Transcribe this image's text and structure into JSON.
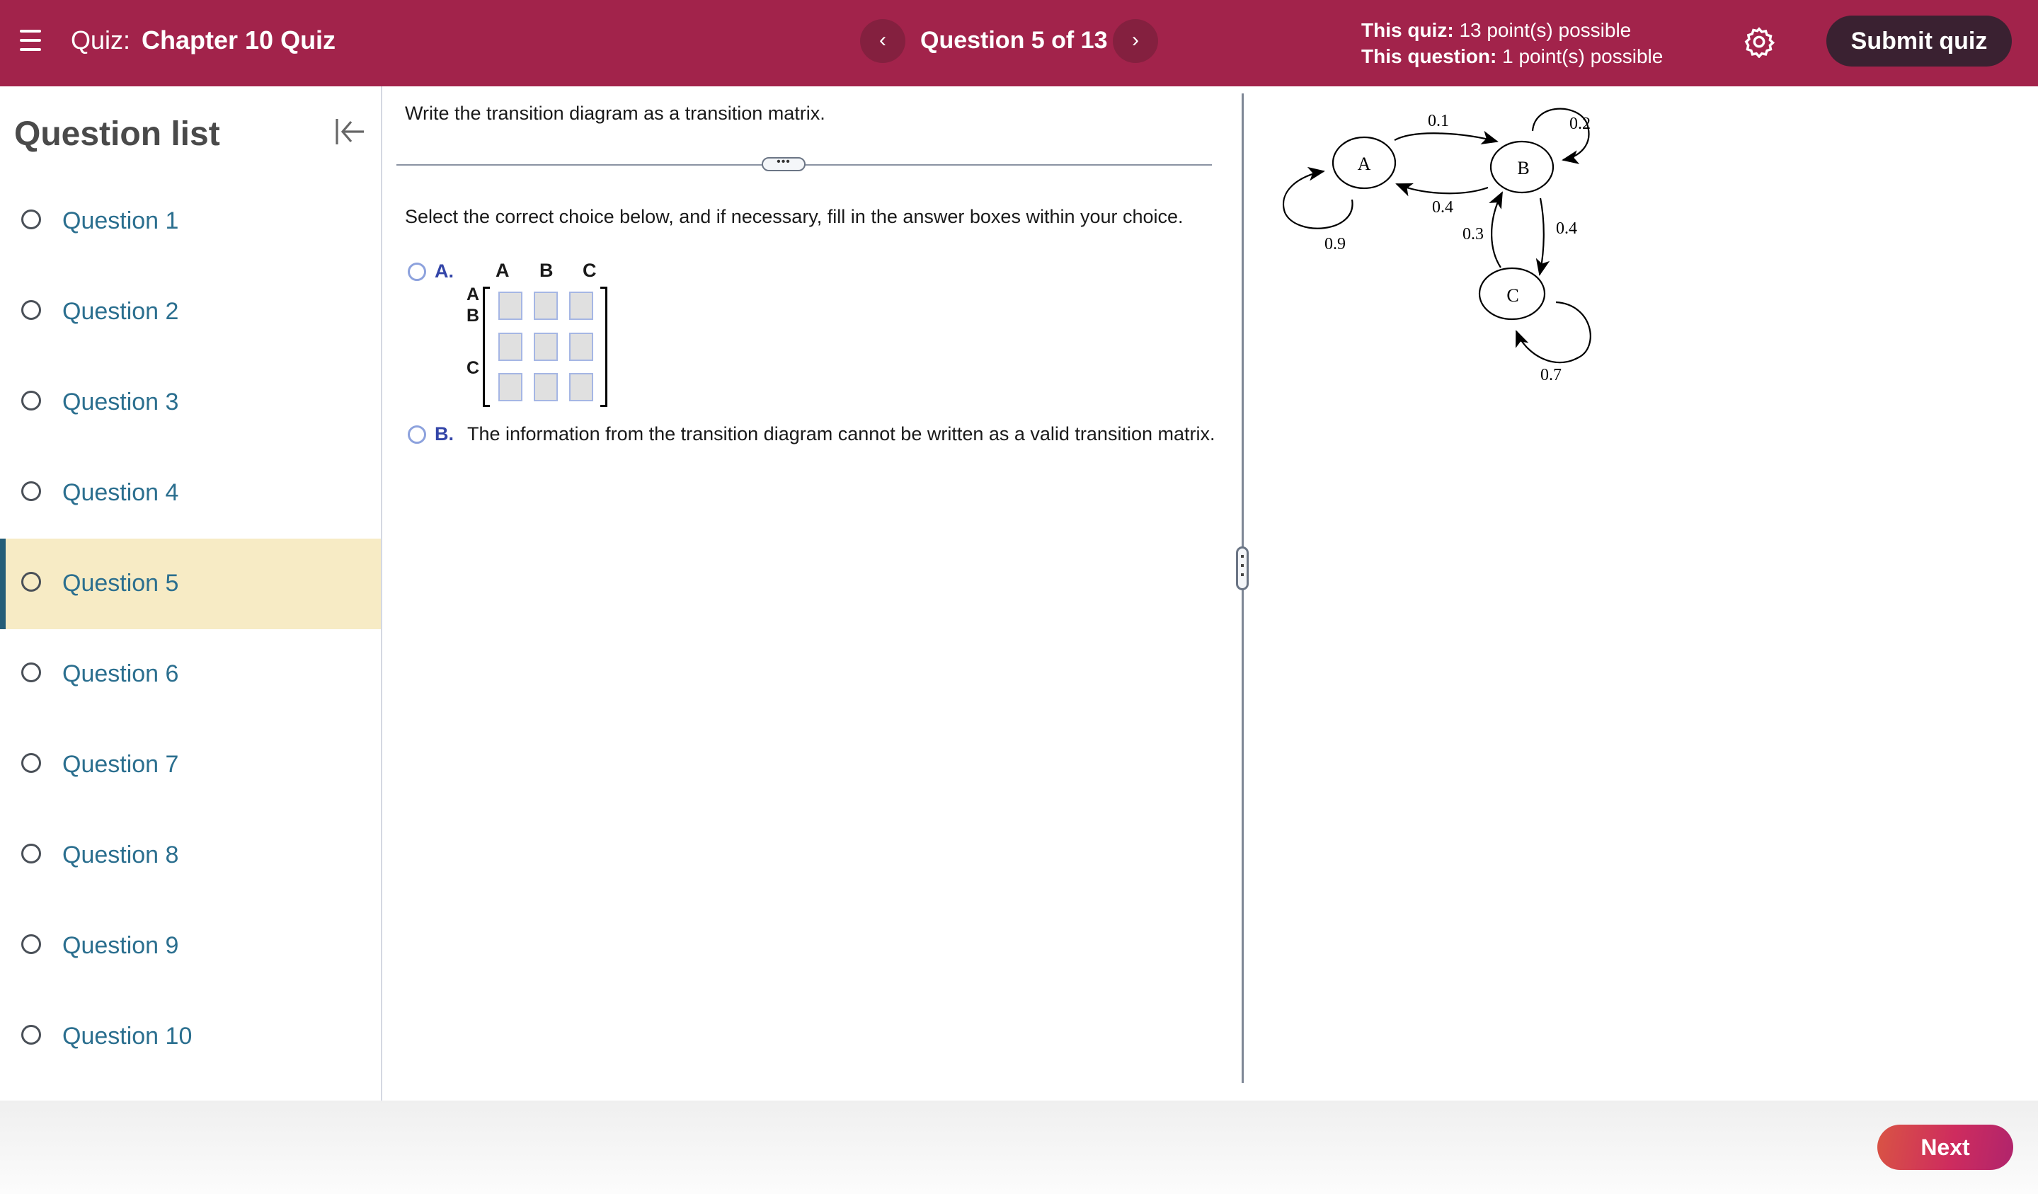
{
  "header": {
    "menu_icon": "hamburger-menu-icon",
    "quiz_label": "Quiz:",
    "quiz_title": "Chapter 10 Quiz",
    "prev_icon": "chevron-left-icon",
    "prev_glyph": "‹",
    "question_counter": "Question 5 of 13",
    "next_icon": "chevron-right-icon",
    "next_glyph": "›",
    "quiz_points_label": "This quiz:",
    "quiz_points_value": "13 point(s) possible",
    "question_points_label": "This question:",
    "question_points_value": "1 point(s) possible",
    "settings_icon": "gear-icon",
    "submit_label": "Submit quiz",
    "colors": {
      "header_bg": "#A2234B",
      "submit_bg": "#3A2131"
    }
  },
  "sidebar": {
    "title": "Question list",
    "collapse_icon": "collapse-left-icon",
    "active_index": 4,
    "items": [
      {
        "label": "Question 1"
      },
      {
        "label": "Question 2"
      },
      {
        "label": "Question 3"
      },
      {
        "label": "Question 4"
      },
      {
        "label": "Question 5"
      },
      {
        "label": "Question 6"
      },
      {
        "label": "Question 7"
      },
      {
        "label": "Question 8"
      },
      {
        "label": "Question 9"
      },
      {
        "label": "Question 10"
      }
    ],
    "colors": {
      "active_bg": "#F7EBC5",
      "active_bar": "#255D78",
      "link": "#2B6F8F"
    }
  },
  "question": {
    "prompt": "Write the transition diagram as a transition matrix.",
    "expand_label": "•••",
    "instruction": "Select the correct choice below, and if necessary, fill in the answer boxes within your choice.",
    "option_a": {
      "letter": "A.",
      "column_headers": [
        "A",
        "B",
        "C"
      ],
      "row_headers": [
        "A",
        "B",
        "C"
      ],
      "cells": [
        [
          "",
          "",
          ""
        ],
        [
          "",
          "",
          ""
        ],
        [
          "",
          "",
          ""
        ]
      ]
    },
    "option_b": {
      "letter": "B.",
      "text": "The information from the transition diagram cannot be written as a valid transition matrix."
    }
  },
  "diagram": {
    "states": [
      "A",
      "B",
      "C"
    ],
    "transitions": [
      {
        "from": "A",
        "to": "A",
        "p": "0.9"
      },
      {
        "from": "A",
        "to": "B",
        "p": "0.1"
      },
      {
        "from": "B",
        "to": "A",
        "p": "0.4"
      },
      {
        "from": "B",
        "to": "B",
        "p": "0.2"
      },
      {
        "from": "B",
        "to": "C",
        "p": "0.4"
      },
      {
        "from": "C",
        "to": "B",
        "p": "0.3"
      },
      {
        "from": "C",
        "to": "C",
        "p": "0.7"
      }
    ]
  },
  "footer": {
    "next_label": "Next"
  }
}
